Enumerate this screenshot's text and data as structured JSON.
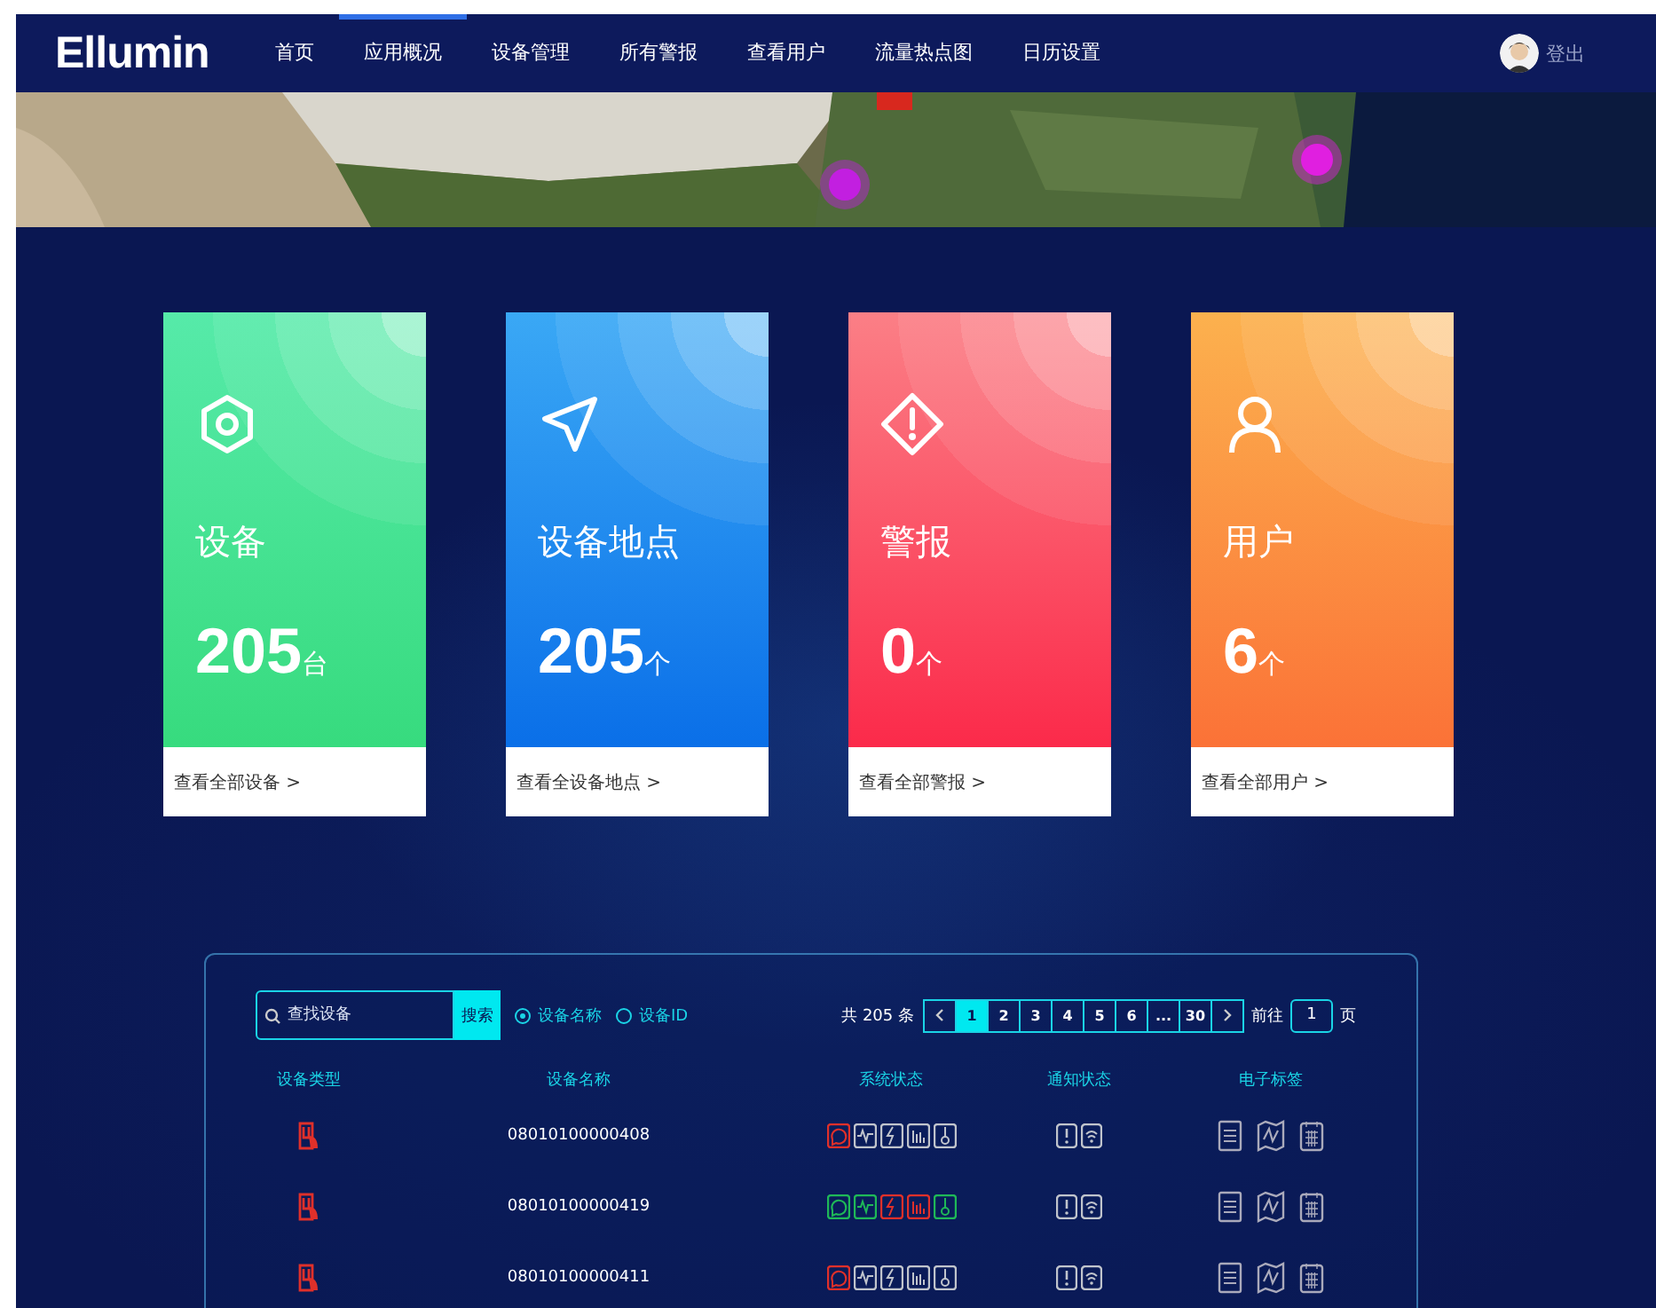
{
  "brand": "Ellumin",
  "nav": [
    {
      "label": "首页",
      "selected": false
    },
    {
      "label": "应用概况",
      "selected": true
    },
    {
      "label": "设备管理",
      "selected": false
    },
    {
      "label": "所有警报",
      "selected": false
    },
    {
      "label": "查看用户",
      "selected": false
    },
    {
      "label": "流量热点图",
      "selected": false
    },
    {
      "label": "日历设置",
      "selected": false
    }
  ],
  "user": {
    "action": "登出"
  },
  "cards": [
    {
      "kind": "device",
      "title": "设备",
      "value": "205",
      "unit": "台",
      "link": "查看全部设备 >"
    },
    {
      "kind": "location",
      "title": "设备地点",
      "value": "205",
      "unit": "个",
      "link": "查看全设备地点 >"
    },
    {
      "kind": "alarm",
      "title": "警报",
      "value": "0",
      "unit": "个",
      "link": "查看全部警报 >"
    },
    {
      "kind": "user",
      "title": "用户",
      "value": "6",
      "unit": "个",
      "link": "查看全部用户 >"
    }
  ],
  "table": {
    "search": {
      "placeholder": "查找设备",
      "button": "搜索"
    },
    "filters": [
      {
        "label": "设备名称",
        "selected": true
      },
      {
        "label": "设备ID",
        "selected": false
      }
    ],
    "total": "共 205 条",
    "pages": [
      {
        "label": "1",
        "selected": true
      },
      {
        "label": "2",
        "selected": false
      },
      {
        "label": "3",
        "selected": false
      },
      {
        "label": "4",
        "selected": false
      },
      {
        "label": "5",
        "selected": false
      },
      {
        "label": "6",
        "selected": false
      },
      {
        "label": "...",
        "selected": false
      },
      {
        "label": "30",
        "selected": false
      }
    ],
    "goto": {
      "label": "前往",
      "value": "1",
      "suffix": "页"
    },
    "columns": [
      "设备类型",
      "设备名称",
      "系统状态",
      "通知状态",
      "电子标签"
    ],
    "rows": [
      {
        "name": "08010100000408",
        "system": [
          {
            "kind": "chat",
            "color": "#e0302a"
          },
          {
            "kind": "pulse",
            "color": "#c0c4cc"
          },
          {
            "kind": "power",
            "color": "#c0c4cc"
          },
          {
            "kind": "bars",
            "color": "#c0c4cc"
          },
          {
            "kind": "temp",
            "color": "#c0c4cc"
          }
        ]
      },
      {
        "name": "08010100000419",
        "system": [
          {
            "kind": "chat",
            "color": "#1fb858"
          },
          {
            "kind": "pulse",
            "color": "#1fb858"
          },
          {
            "kind": "power",
            "color": "#e0302a"
          },
          {
            "kind": "bars",
            "color": "#e0302a"
          },
          {
            "kind": "temp",
            "color": "#1fb858"
          }
        ]
      },
      {
        "name": "08010100000411",
        "system": [
          {
            "kind": "chat",
            "color": "#e0302a"
          },
          {
            "kind": "pulse",
            "color": "#c0c4cc"
          },
          {
            "kind": "power",
            "color": "#c0c4cc"
          },
          {
            "kind": "bars",
            "color": "#c0c4cc"
          },
          {
            "kind": "temp",
            "color": "#c0c4cc"
          }
        ]
      }
    ]
  }
}
